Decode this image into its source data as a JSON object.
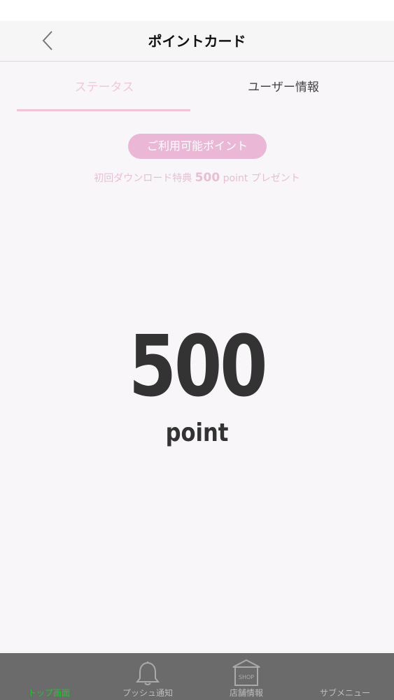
{
  "nav": {
    "title": "ポイントカード"
  },
  "tabs": {
    "status": "ステータス",
    "user_info": "ユーザー情報"
  },
  "points": {
    "pill_label": "ご利用可能ポイント",
    "promo_prefix": "初回ダウンロード特典",
    "promo_amount": "500",
    "promo_suffix": "point プレゼント",
    "value": "500",
    "unit": "point"
  },
  "bottom_nav": {
    "items": [
      {
        "label": "トップ画面",
        "icon": "home-icon"
      },
      {
        "label": "プッシュ通知",
        "icon": "bell-icon"
      },
      {
        "label": "店舗情報",
        "icon": "shop-icon",
        "icon_text": "SHOP"
      },
      {
        "label": "サブメニュー",
        "icon": "menu-icon"
      }
    ],
    "active_color": "#22c52a"
  },
  "colors": {
    "accent_pink": "#eab8d6",
    "tab_active": "#f0c8d8"
  }
}
